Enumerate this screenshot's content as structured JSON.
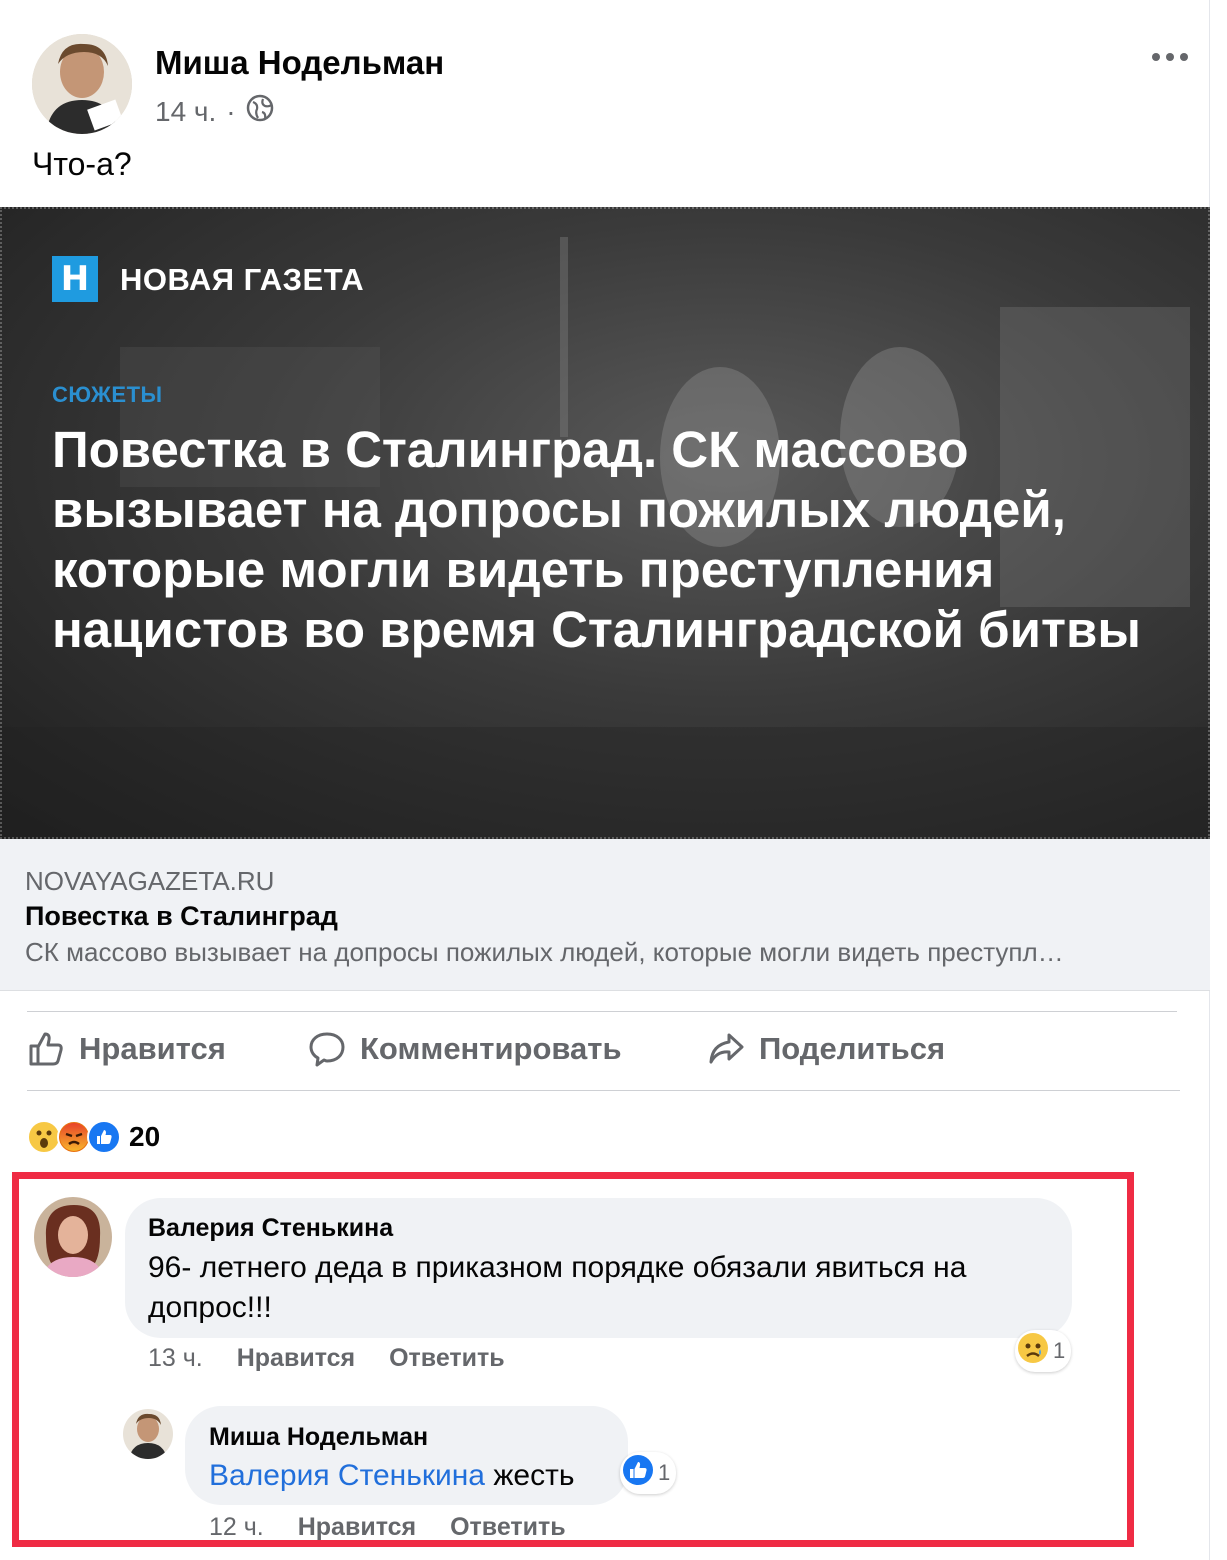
{
  "post": {
    "author": "Миша Нодельман",
    "time": "14 ч.",
    "separator": "·",
    "text": "Что-а?"
  },
  "link_image": {
    "publisher": "НОВАЯ ГАЗЕТА",
    "section": "СЮЖЕТЫ",
    "headline": "Повестка в Сталинград. СК массово вызывает на допросы пожилых людей, которые могли видеть преступления нацистов во время Сталинградской битвы"
  },
  "link_preview": {
    "domain": "NOVAYAGAZETA.RU",
    "title": "Повестка в Сталинград",
    "description": "СК массово вызывает на допросы пожилых людей, которые могли видеть преступл…"
  },
  "actions": {
    "like": "Нравится",
    "comment": "Комментировать",
    "share": "Поделиться"
  },
  "reactions": {
    "icons": [
      "wow-icon",
      "angry-icon",
      "like-icon"
    ],
    "count": "20"
  },
  "comments": [
    {
      "author": "Валерия Стенькина",
      "text": "96- летнего деда в приказном порядке обязали явиться на допрос!!!",
      "time": "13 ч.",
      "like_label": "Нравится",
      "reply_label": "Ответить",
      "reaction_icon": "sad-icon",
      "reaction_count": "1",
      "reply": {
        "author": "Миша Нодельман",
        "mention": "Валерия Стенькина",
        "text": " жесть",
        "time": "12 ч.",
        "like_label": "Нравится",
        "reply_label": "Ответить",
        "reaction_icon": "like-icon",
        "reaction_count": "1"
      }
    }
  ],
  "colors": {
    "accent_blue": "#216fdb",
    "highlight_red": "#ef2b44",
    "secondary_text": "#65676b",
    "bubble_bg": "#f0f2f5",
    "brand_blue": "#1f9be0"
  }
}
